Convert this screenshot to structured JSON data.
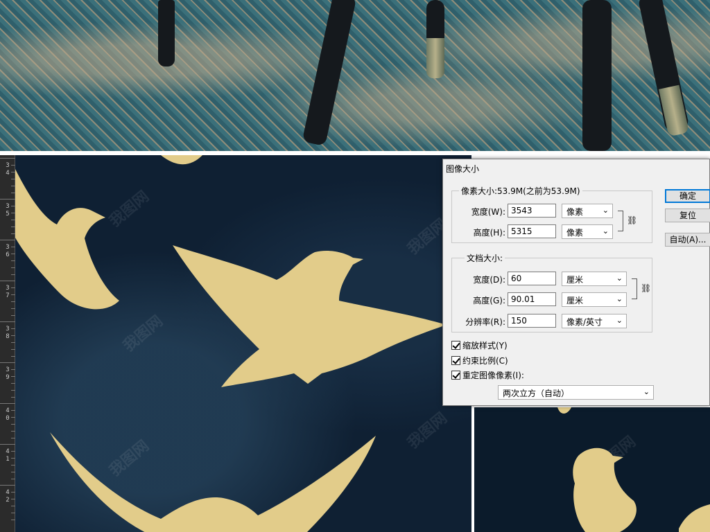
{
  "ruler": {
    "labels": [
      [
        "3",
        "4"
      ],
      [
        "3",
        "5"
      ],
      [
        "3",
        "6"
      ],
      [
        "3",
        "7"
      ],
      [
        "3",
        "8"
      ],
      [
        "3",
        "9"
      ],
      [
        "4",
        "0"
      ],
      [
        "4",
        "1"
      ],
      [
        "4",
        "2"
      ]
    ]
  },
  "watermark": "我图网",
  "dialog": {
    "title": "图像大小",
    "pixel_group": {
      "legend": "像素大小:53.9M(之前为53.9M)",
      "width_label": "宽度(W):",
      "width_value": "3543",
      "width_unit": "像素",
      "height_label": "高度(H):",
      "height_value": "5315",
      "height_unit": "像素"
    },
    "doc_group": {
      "legend": "文档大小:",
      "width_label": "宽度(D):",
      "width_value": "60",
      "width_unit": "厘米",
      "height_label": "高度(G):",
      "height_value": "90.01",
      "height_unit": "厘米",
      "resolution_label": "分辨率(R):",
      "resolution_value": "150",
      "resolution_unit": "像素/英寸"
    },
    "buttons": {
      "ok": "确定",
      "reset": "复位",
      "auto": "自动(A)..."
    },
    "checks": {
      "scale_styles": "缩放样式(Y)",
      "constrain": "约束比例(C)",
      "resample": "重定图像像素(I):"
    },
    "resample_method": "两次立方（自动）"
  },
  "colors": {
    "canvas_bg": "#0f2033",
    "bird_gold": "#e2cc8a",
    "dialog_bg": "#f0f0f0"
  }
}
